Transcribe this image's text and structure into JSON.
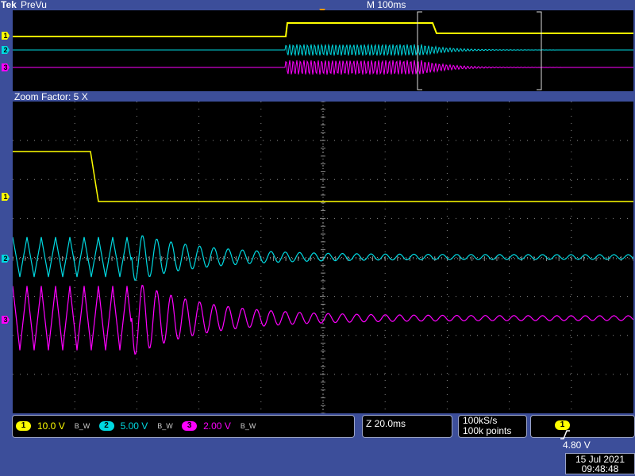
{
  "header": {
    "brand": "Tek",
    "acq_state": "PreVu",
    "timebase": "M 100ms"
  },
  "zoom": {
    "label": "Zoom Factor: 5 X"
  },
  "channels": [
    {
      "id": "1",
      "label": "1",
      "scale": "10.0 V",
      "bandwidth": "B_W",
      "color": "#ffff00"
    },
    {
      "id": "2",
      "label": "2",
      "scale": "5.00 V",
      "bandwidth": "B_W",
      "color": "#00d8e0"
    },
    {
      "id": "3",
      "label": "3",
      "scale": "2.00 V",
      "bandwidth": "B_W",
      "color": "#ff00ff"
    }
  ],
  "zoom_time": "Z 20.0ms",
  "acquisition": {
    "rate": "100kS/s",
    "points": "100k points"
  },
  "trigger": {
    "source": "1",
    "slope": "rising-edge-icon",
    "level": "4.80 V"
  },
  "clock": {
    "date": "15 Jul   2021",
    "time": "09:48:48"
  },
  "colors": {
    "background": "#3c4e9a",
    "screen": "#000000",
    "grid": "#8a8a8a",
    "ch1": "#ffff00",
    "ch2": "#00d8e0",
    "ch3": "#ff00ff",
    "trigger_marker": "#ff9900"
  }
}
